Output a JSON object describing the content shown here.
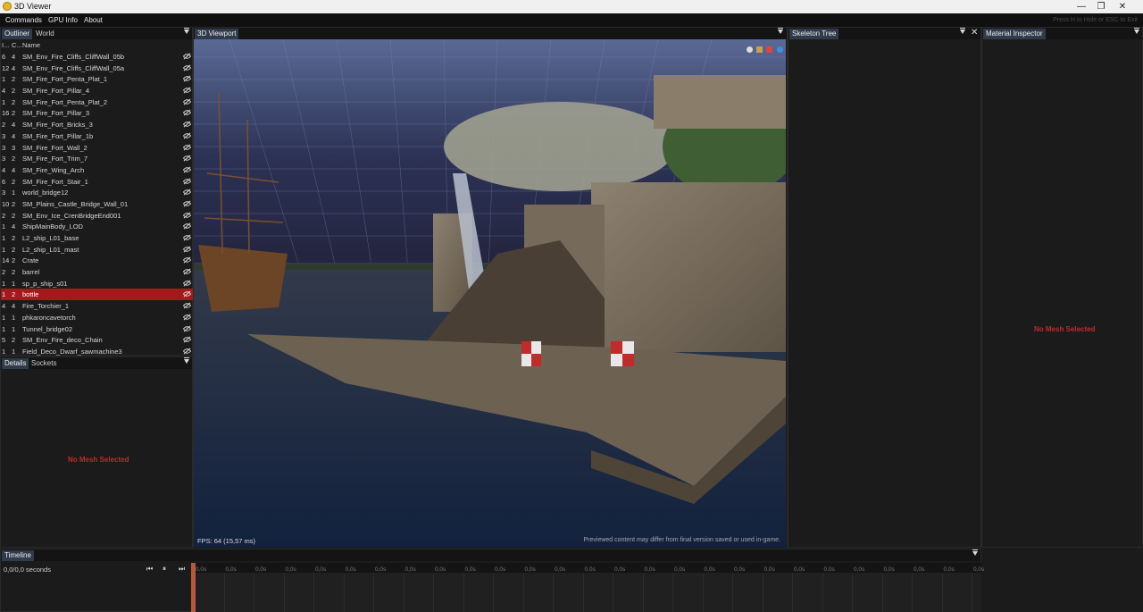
{
  "window": {
    "title": "3D Viewer",
    "min": "—",
    "max": "❐",
    "close": "✕"
  },
  "menu": {
    "items": [
      "Commands",
      "GPU Info",
      "About"
    ],
    "hint": "Press H to Hide or ESC to Exit"
  },
  "outliner": {
    "tabs": [
      "Outliner",
      "World"
    ],
    "columns": [
      "I...",
      "C...",
      "Name"
    ],
    "rows": [
      {
        "i": "6",
        "c": "4",
        "name": "SM_Env_Fire_Cliffs_CliffWall_05b"
      },
      {
        "i": "12",
        "c": "4",
        "name": "SM_Env_Fire_Cliffs_CliffWall_05a"
      },
      {
        "i": "1",
        "c": "2",
        "name": "SM_Fire_Fort_Penta_Plat_1"
      },
      {
        "i": "4",
        "c": "2",
        "name": "SM_Fire_Fort_Pillar_4"
      },
      {
        "i": "1",
        "c": "2",
        "name": "SM_Fire_Fort_Penta_Plat_2"
      },
      {
        "i": "16",
        "c": "2",
        "name": "SM_Fire_Fort_Pillar_3"
      },
      {
        "i": "2",
        "c": "4",
        "name": "SM_Fire_Fort_Bricks_3"
      },
      {
        "i": "3",
        "c": "4",
        "name": "SM_Fire_Fort_Pillar_1b"
      },
      {
        "i": "3",
        "c": "3",
        "name": "SM_Fire_Fort_Wall_2"
      },
      {
        "i": "3",
        "c": "2",
        "name": "SM_Fire_Fort_Trim_7"
      },
      {
        "i": "4",
        "c": "4",
        "name": "SM_Fire_Wing_Arch"
      },
      {
        "i": "6",
        "c": "2",
        "name": "SM_Fire_Fort_Stair_1"
      },
      {
        "i": "3",
        "c": "1",
        "name": "world_bridge12"
      },
      {
        "i": "10",
        "c": "2",
        "name": "SM_Plains_Castle_Bridge_Wall_01"
      },
      {
        "i": "2",
        "c": "2",
        "name": "SM_Env_Ice_CrenBridgeEnd001"
      },
      {
        "i": "1",
        "c": "4",
        "name": "ShipMainBody_LOD"
      },
      {
        "i": "1",
        "c": "2",
        "name": "L2_ship_L01_base"
      },
      {
        "i": "1",
        "c": "2",
        "name": "L2_ship_L01_mast"
      },
      {
        "i": "14",
        "c": "2",
        "name": "Crate"
      },
      {
        "i": "2",
        "c": "2",
        "name": "barrel"
      },
      {
        "i": "1",
        "c": "1",
        "name": "sp_p_ship_s01"
      },
      {
        "i": "1",
        "c": "2",
        "name": "bottle",
        "selected": true
      },
      {
        "i": "4",
        "c": "4",
        "name": "Fire_Torchier_1"
      },
      {
        "i": "1",
        "c": "1",
        "name": "phkaroncavetorch"
      },
      {
        "i": "1",
        "c": "1",
        "name": "Tunnel_bridge02"
      },
      {
        "i": "5",
        "c": "2",
        "name": "SM_Env_Fire_deco_Chain"
      },
      {
        "i": "1",
        "c": "1",
        "name": "Field_Deco_Dwarf_sawmachine3"
      }
    ]
  },
  "details": {
    "tabs": [
      "Details",
      "Sockets"
    ],
    "empty": "No Mesh Selected"
  },
  "viewport": {
    "tab": "3D Viewport",
    "fps": "FPS: 64 (15,57 ms)",
    "notice": "Previewed content may differ from final version saved or used in-game."
  },
  "skeleton": {
    "tab": "Skeleton Tree"
  },
  "material": {
    "tab": "Material Inspector",
    "empty": "No Mesh Selected"
  },
  "timeline": {
    "tab": "Timeline",
    "time": "0,0/0,0 seconds",
    "controls": [
      "⏮",
      "⏸",
      "⏭"
    ],
    "tick_label": "0,0s"
  }
}
